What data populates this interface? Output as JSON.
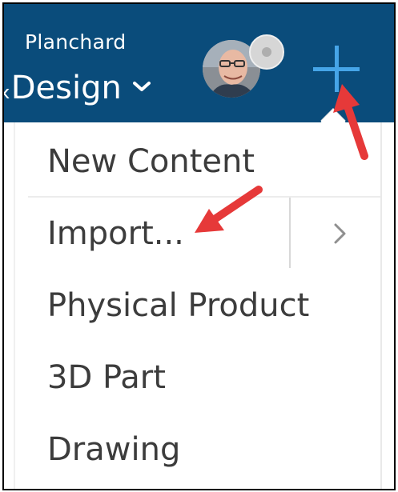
{
  "header": {
    "user_name": "Planchard",
    "app_name": "xDesign",
    "app_name_visible": "ₓDesign"
  },
  "menu": {
    "items": [
      {
        "label": "New Content"
      },
      {
        "label": "Import..."
      },
      {
        "label": "Physical Product"
      },
      {
        "label": "3D Part"
      },
      {
        "label": "Drawing"
      }
    ],
    "submenu_arrow": ">"
  },
  "icons": {
    "app_switcher": "chevron-down-icon",
    "create": "plus-icon",
    "submenu": "chevron-right-icon",
    "annotation": "red-arrow-icon"
  },
  "colors": {
    "topbar": "#0a4c7b",
    "plus": "#46a5e8",
    "menu_text": "#3c3c3c",
    "annotation_arrow": "#e63939"
  }
}
